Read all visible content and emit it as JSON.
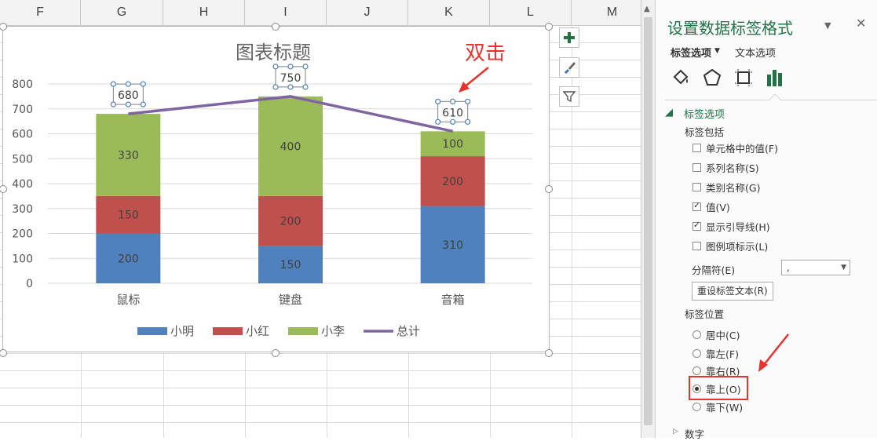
{
  "sheet": {
    "columns": [
      "F",
      "G",
      "H",
      "I",
      "J",
      "K",
      "L",
      "M"
    ]
  },
  "chart_data": {
    "type": "bar",
    "title": "图表标题",
    "categories": [
      "鼠标",
      "键盘",
      "音箱"
    ],
    "series": [
      {
        "name": "小明",
        "values": [
          200,
          150,
          310
        ],
        "color": "#4f81bd"
      },
      {
        "name": "小红",
        "values": [
          150,
          200,
          200
        ],
        "color": "#c0504d"
      },
      {
        "name": "小李",
        "values": [
          330,
          400,
          100
        ],
        "color": "#9bbb59"
      },
      {
        "name": "总计",
        "values": [
          680,
          750,
          610
        ],
        "color": "#8064a2",
        "kind": "line"
      }
    ],
    "ylim": [
      0,
      800
    ],
    "yticks": [
      0,
      100,
      200,
      300,
      400,
      500,
      600,
      700,
      800
    ],
    "legend": "bottom",
    "grid": true
  },
  "annotations": {
    "double_click": "双击"
  },
  "chart_buttons": [
    "plus-icon",
    "brush-icon",
    "filter-icon"
  ],
  "pane": {
    "title": "设置数据标签格式",
    "tabs": [
      "标签选项",
      "文本选项"
    ],
    "section_label_options": "标签选项",
    "label_contains": "标签包括",
    "checkboxes": [
      {
        "label": "单元格中的值(F)",
        "checked": false
      },
      {
        "label": "系列名称(S)",
        "checked": false
      },
      {
        "label": "类别名称(G)",
        "checked": false
      },
      {
        "label": "值(V)",
        "checked": true
      },
      {
        "label": "显示引导线(H)",
        "checked": true
      },
      {
        "label": "图例项标示(L)",
        "checked": false
      }
    ],
    "separator_label": "分隔符(E)",
    "separator_value": ",",
    "reset_button": "重设标签文本(R)",
    "label_position": "标签位置",
    "radios": [
      {
        "label": "居中(C)",
        "selected": false
      },
      {
        "label": "靠左(F)",
        "selected": false
      },
      {
        "label": "靠右(R)",
        "selected": false
      },
      {
        "label": "靠上(O)",
        "selected": true
      },
      {
        "label": "靠下(W)",
        "selected": false
      }
    ],
    "section_number": "数字"
  }
}
